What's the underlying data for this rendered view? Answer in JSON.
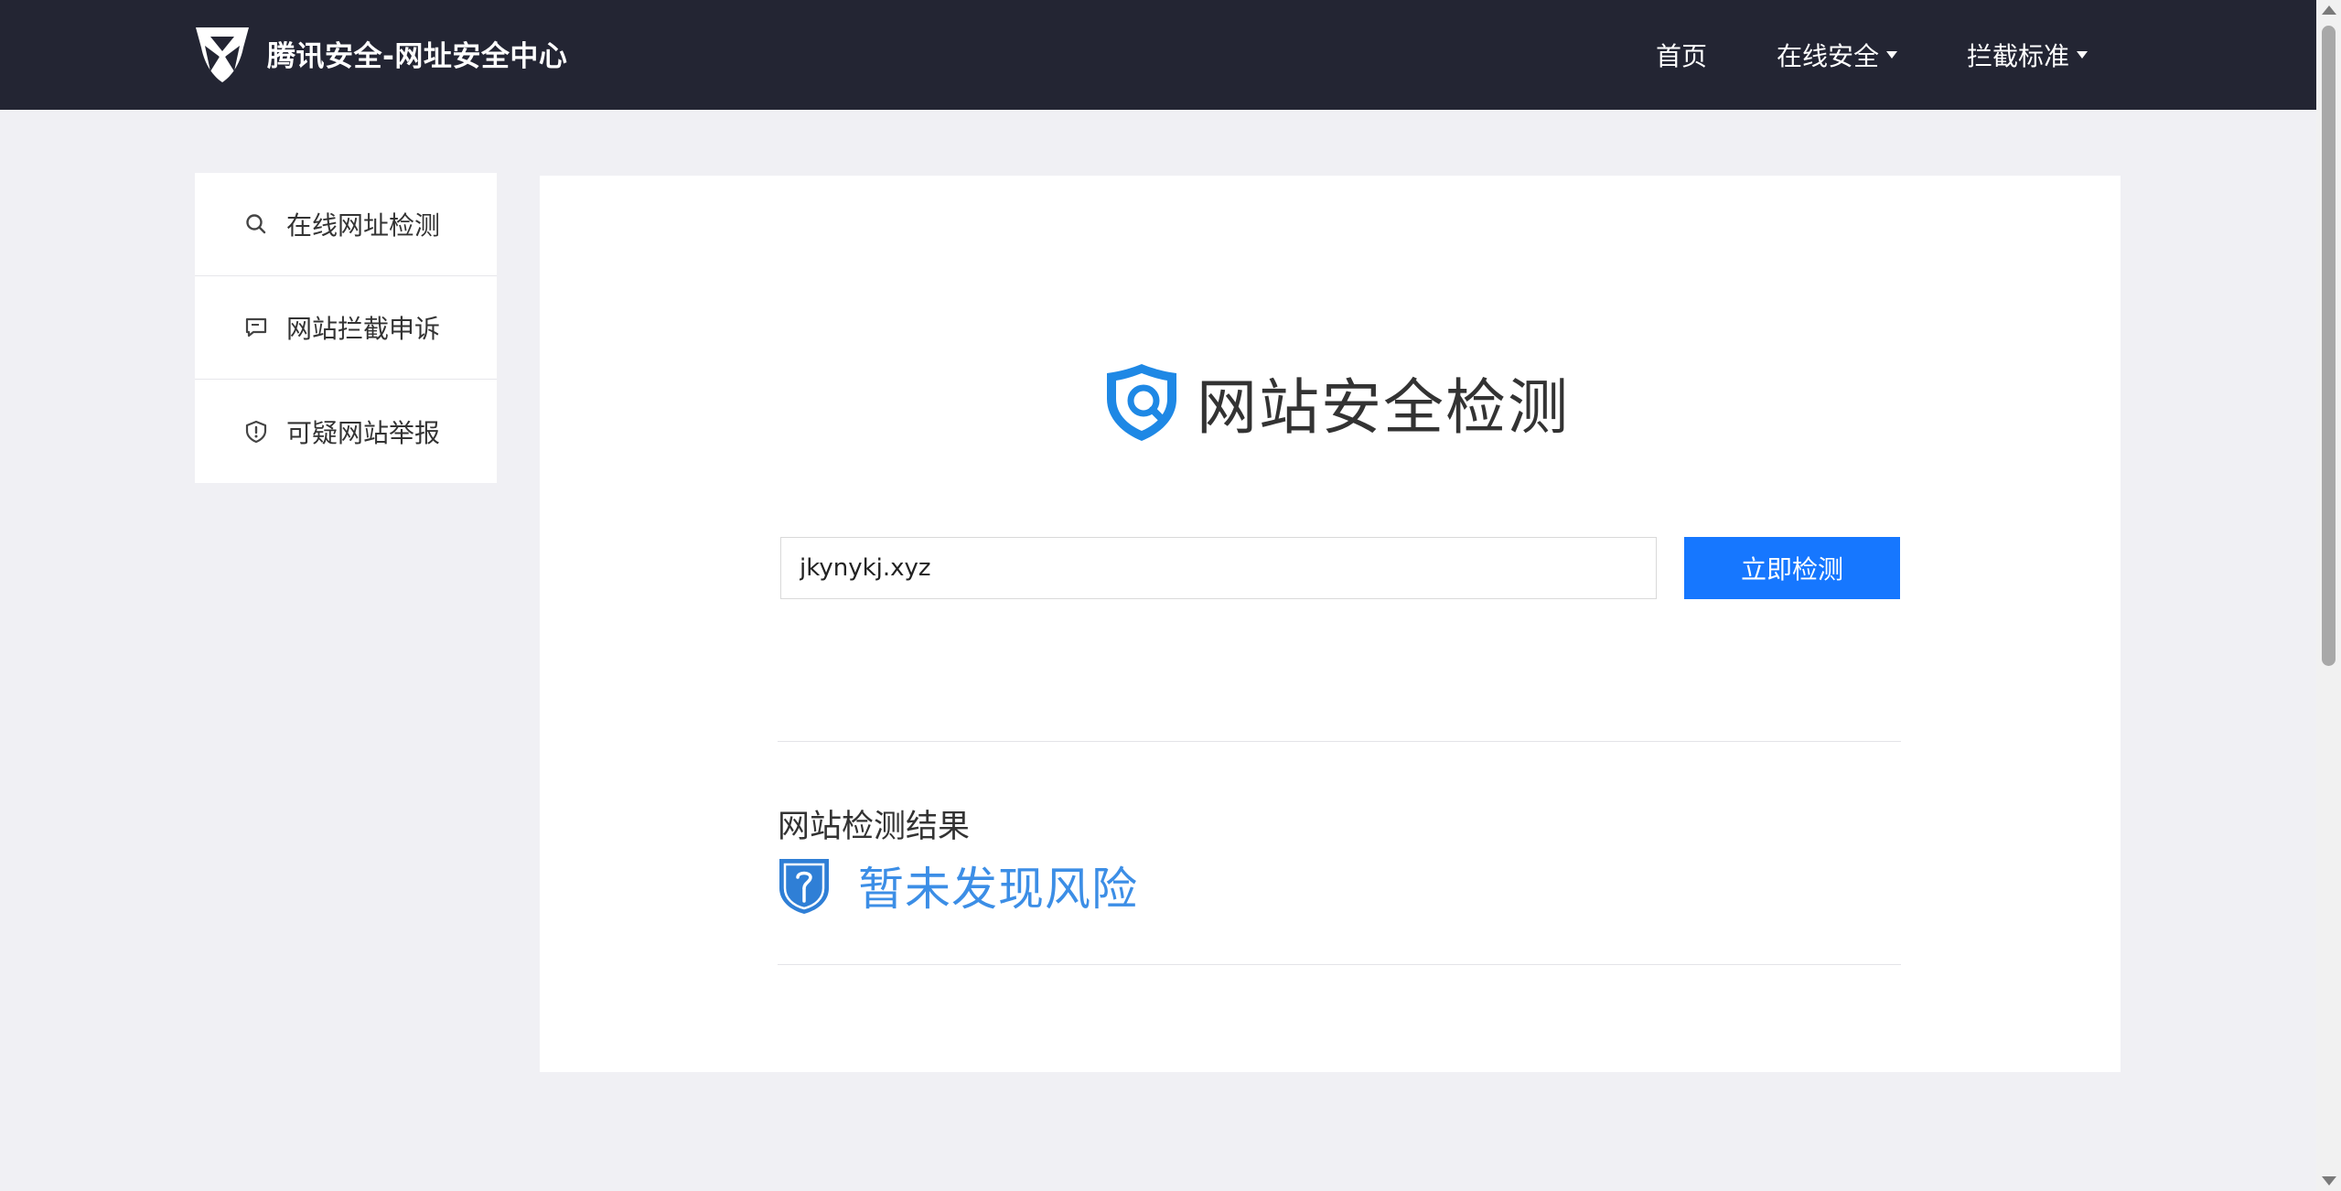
{
  "header": {
    "site_title": "腾讯安全-网址安全中心",
    "nav": [
      {
        "label": "首页",
        "dropdown": false
      },
      {
        "label": "在线安全",
        "dropdown": true
      },
      {
        "label": "拦截标准",
        "dropdown": true
      }
    ]
  },
  "sidebar": {
    "items": [
      {
        "label": "在线网址检测",
        "icon": "search-icon"
      },
      {
        "label": "网站拦截申诉",
        "icon": "comment-icon"
      },
      {
        "label": "可疑网站举报",
        "icon": "shield-alert-icon"
      }
    ]
  },
  "main": {
    "hero_title": "网站安全检测",
    "search": {
      "value": "jkynykj.xyz",
      "button_label": "立即检测"
    },
    "result": {
      "title": "网站检测结果",
      "status": "暂未发现风险"
    }
  },
  "colors": {
    "topbar": "#232533",
    "accent": "#1677ff",
    "result_status": "#3c8ee6",
    "background": "#f0f0f4"
  }
}
